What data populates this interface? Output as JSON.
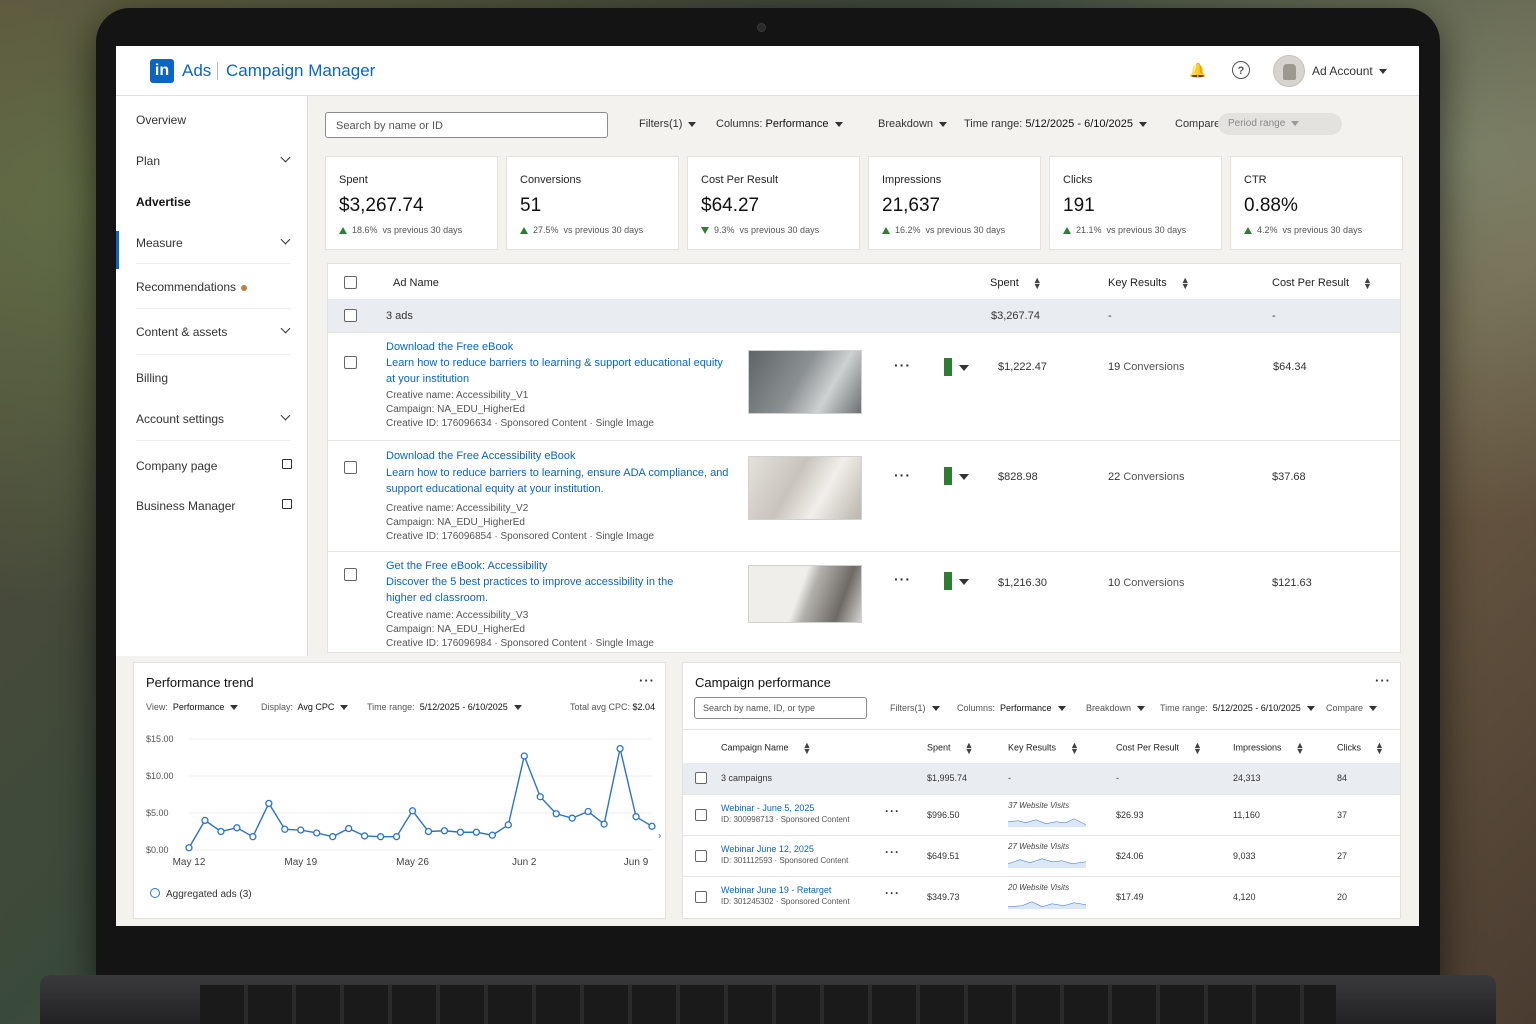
{
  "header": {
    "brand": "Ads",
    "app_title": "Campaign Manager",
    "logo_text": "in",
    "account": "Ad Account"
  },
  "sidebar": {
    "items": [
      {
        "label": "Overview"
      },
      {
        "label": "Plan"
      },
      {
        "label": "Advertise"
      },
      {
        "label": "Measure"
      },
      {
        "label": "Recommendations"
      },
      {
        "label": "Content & assets"
      },
      {
        "label": "Billing"
      },
      {
        "label": "Account settings"
      },
      {
        "label": "Company page"
      },
      {
        "label": "Business Manager"
      }
    ]
  },
  "toolbar": {
    "search_placeholder": "Search by name or ID",
    "filters": "Filters(1)",
    "columns_label": "Columns:",
    "columns_value": "Performance",
    "breakdown": "Breakdown",
    "time_label": "Time range:",
    "time_value": "5/12/2025 - 6/10/2025",
    "compare": "Compare",
    "period": "Period range"
  },
  "metrics": [
    {
      "label": "Spent",
      "value": "$3,267.74",
      "change": "18.6%",
      "dir": "up",
      "note": "vs previous 30 days"
    },
    {
      "label": "Conversions",
      "value": "51",
      "change": "27.5%",
      "dir": "up",
      "note": "vs previous 30 days"
    },
    {
      "label": "Cost Per Result",
      "value": "$64.27",
      "change": "9.3%",
      "dir": "down",
      "note": "vs previous 30 days"
    },
    {
      "label": "Impressions",
      "value": "21,637",
      "change": "16.2%",
      "dir": "up",
      "note": "vs previous 30 days"
    },
    {
      "label": "Clicks",
      "value": "191",
      "change": "21.1%",
      "dir": "up",
      "note": "vs previous 30 days"
    },
    {
      "label": "CTR",
      "value": "0.88%",
      "change": "4.2%",
      "dir": "up",
      "note": "vs previous 30 days"
    }
  ],
  "ads": {
    "columns": {
      "name": "Ad Name",
      "spent": "Spent",
      "key_results": "Key Results",
      "cpr": "Cost Per Result"
    },
    "aggregate": {
      "label": "3 ads",
      "spent": "$3,267.74",
      "key_results": "-",
      "cpr": "-"
    },
    "rows": [
      {
        "headline": "Download the Free eBook",
        "body": "Learn how to reduce barriers to learning & support educational equity at your institution",
        "creative": "Creative name: Accessibility_V1",
        "campaign": "Campaign: NA_EDU_HigherEd",
        "cid": "Creative ID:  176096634 · Sponsored Content · Single Image",
        "spent": "$1,222.47",
        "kr_num": "19",
        "kr_unit": "Conversions",
        "cpr": "$64.34"
      },
      {
        "headline": "Download the Free Accessibility eBook",
        "body": "Learn how to reduce barriers to learning, ensure ADA compliance, and support educational equity at your institution.",
        "creative": "Creative name: Accessibility_V2",
        "campaign": "Campaign: NA_EDU_HigherEd",
        "cid": "Creative ID:  176096854 · Sponsored Content · Single Image",
        "spent": "$828.98",
        "kr_num": "22",
        "kr_unit": "Conversions",
        "cpr": "$37.68"
      },
      {
        "headline": "Get the Free eBook: Accessibility",
        "body": "Discover the 5 best practices to improve accessibility in the higher ed classroom.",
        "creative": "Creative name: Accessibility_V3",
        "campaign": "Campaign: NA_EDU_HigherEd",
        "cid": "Creative ID:  176096984 · Sponsored Content · Single Image",
        "spent": "$1,216.30",
        "kr_num": "10",
        "kr_unit": "Conversions",
        "cpr": "$121.63"
      }
    ]
  },
  "trend": {
    "title": "Performance trend",
    "view_label": "View:",
    "view_value": "Performance",
    "display_label": "Display:",
    "display_value": "Avg CPC",
    "time_label": "Time range:",
    "time_value": "5/12/2025 - 6/10/2025",
    "total_label": "Total avg CPC:",
    "total_value": "$2.04",
    "legend": "Aggregated ads (3)"
  },
  "chart_data": {
    "type": "line",
    "y_ticks": [
      "$15.00",
      "$10.00",
      "$5.00",
      "$0.00"
    ],
    "ylim": [
      0,
      15
    ],
    "x_labels": [
      "May 12",
      "May 19",
      "May 26",
      "Jun 2",
      "Jun 9"
    ],
    "x_label_days": [
      0,
      7,
      14,
      21,
      28
    ],
    "series": [
      {
        "name": "Aggregated ads (3)",
        "values": [
          0.3,
          4.0,
          2.5,
          3.0,
          1.8,
          6.3,
          2.8,
          2.7,
          2.3,
          1.8,
          2.9,
          1.9,
          1.8,
          1.8,
          5.3,
          2.5,
          2.6,
          2.4,
          2.4,
          2.0,
          3.4,
          12.7,
          7.2,
          4.9,
          4.3,
          5.2,
          3.5,
          13.7,
          4.5,
          3.2
        ]
      }
    ],
    "xlim": [
      0,
      29
    ]
  },
  "campaigns": {
    "title": "Campaign performance",
    "search_placeholder": "Search by name, ID, or type",
    "filters": "Filters(1)",
    "columns_label": "Columns:",
    "columns_value": "Performance",
    "breakdown": "Breakdown",
    "time_label": "Time range:",
    "time_value": "5/12/2025 - 6/10/2025",
    "compare": "Compare",
    "columns": {
      "name": "Campaign Name",
      "spent": "Spent",
      "key_results": "Key Results",
      "cpr": "Cost Per Result",
      "impressions": "Impressions",
      "clicks": "Clicks"
    },
    "aggregate": {
      "label": "3 campaigns",
      "spent": "$1,995.74",
      "key_results": "-",
      "cpr": "-",
      "impressions": "24,313",
      "clicks": "84"
    },
    "rows": [
      {
        "name": "Webinar - June 5, 2025",
        "id": "ID: 300998713 · Sponsored Content",
        "spent": "$996.50",
        "kr": "37 Website Visits",
        "cpr": "$26.93",
        "impressions": "11,160",
        "clicks": "37"
      },
      {
        "name": "Webinar June 12, 2025",
        "id": "ID: 301112593 · Sponsored Content",
        "spent": "$649.51",
        "kr": "27 Website Visits",
        "cpr": "$24.06",
        "impressions": "9,033",
        "clicks": "27"
      },
      {
        "name": "Webinar June 19 - Retarget",
        "id": "ID: 301245302 · Sponsored Content",
        "spent": "$349.73",
        "kr": "20 Website Visits",
        "cpr": "$17.49",
        "impressions": "4,120",
        "clicks": "20"
      }
    ]
  }
}
